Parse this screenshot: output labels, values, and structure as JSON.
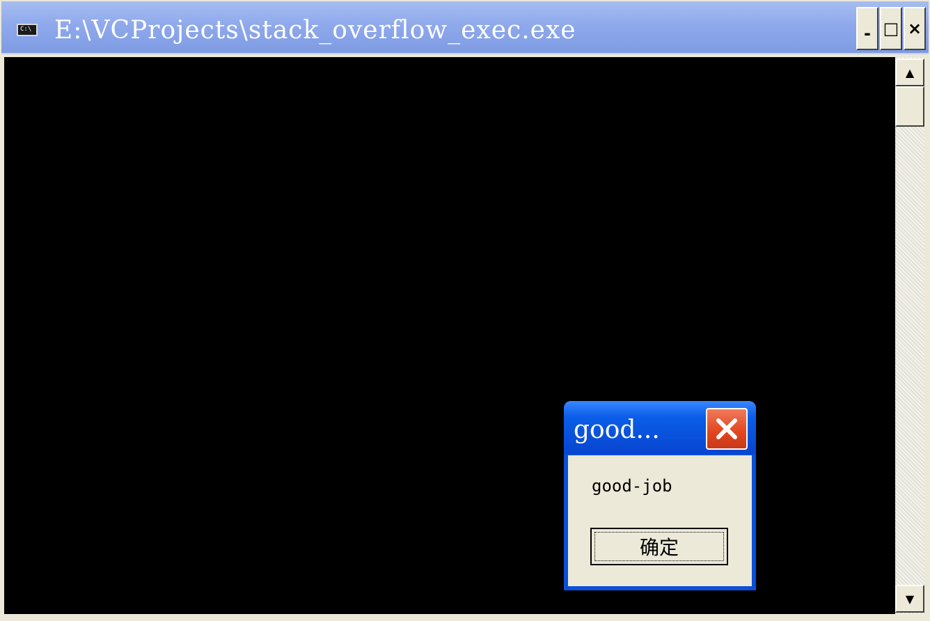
{
  "console_window": {
    "title": "E:\\VCProjects\\stack_overflow_exec.exe",
    "icon_text": "C:\\",
    "controls": {
      "minimize": "-",
      "maximize": "□",
      "close": "×"
    },
    "scrollbar": {
      "up_arrow": "▲",
      "down_arrow": "▼"
    }
  },
  "message_box": {
    "title": "good...",
    "message": "good-job",
    "ok_label": "确定"
  }
}
